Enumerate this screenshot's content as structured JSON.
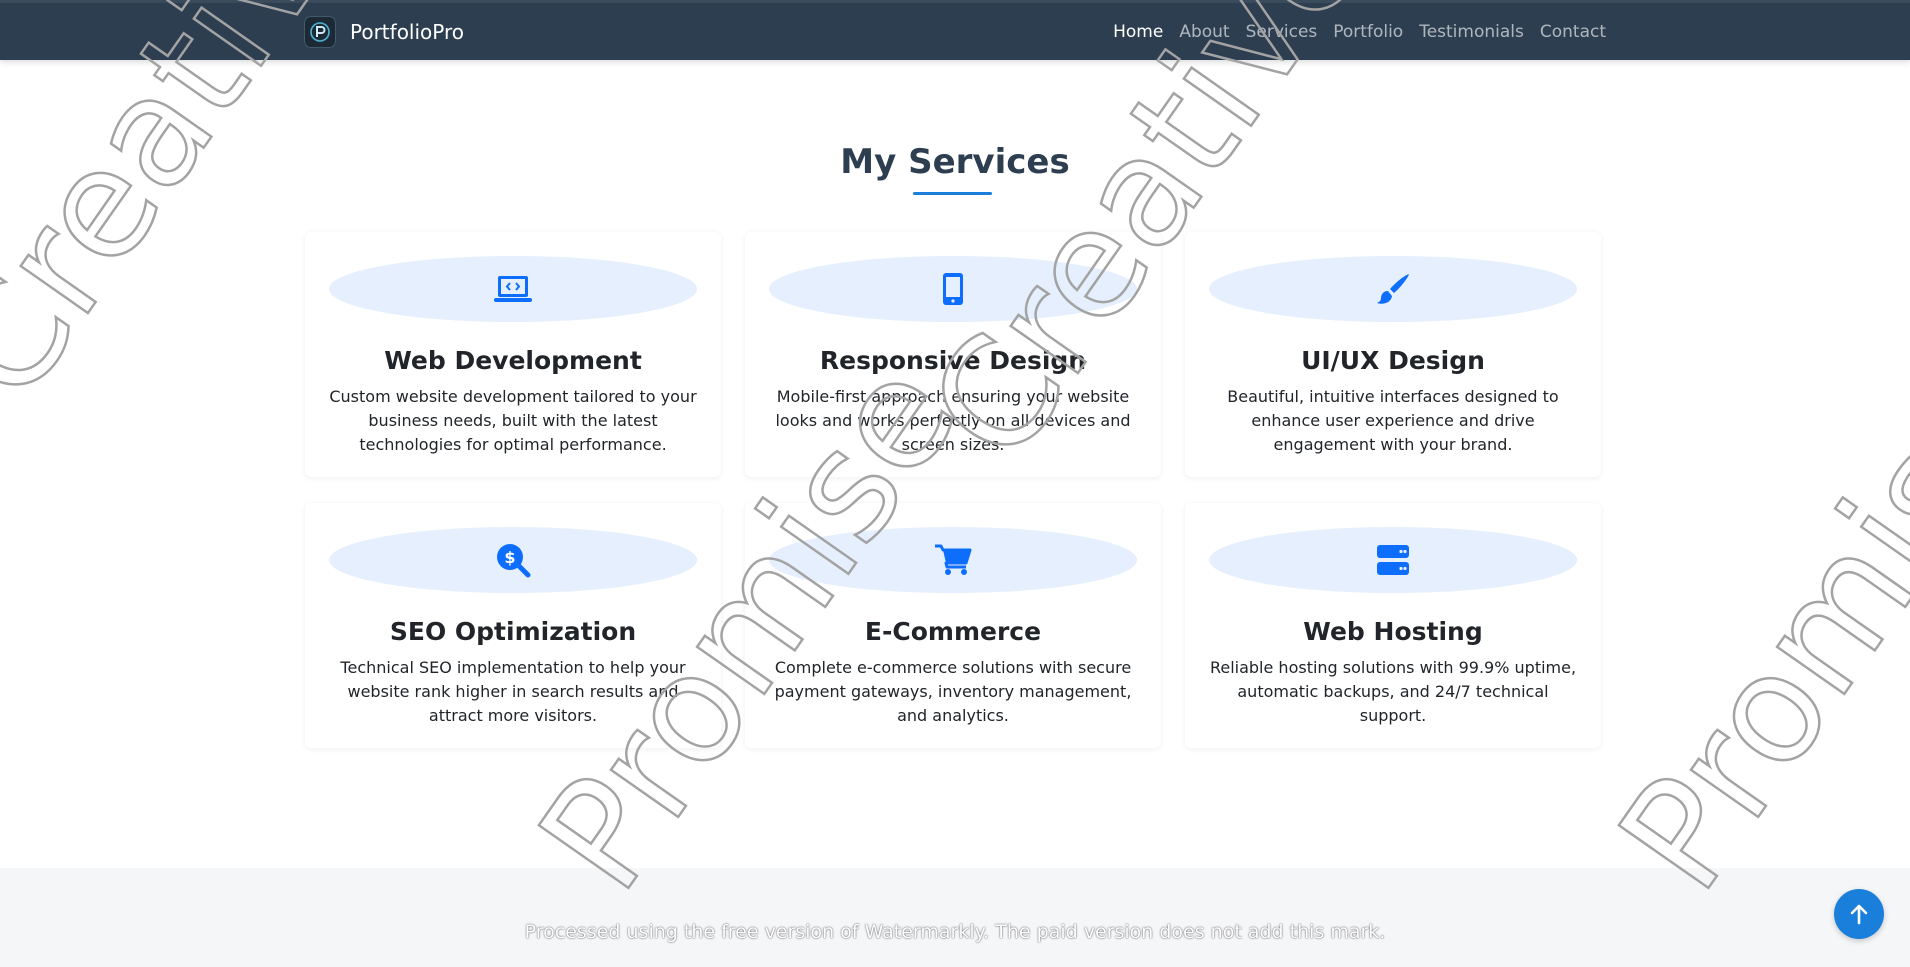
{
  "nav": {
    "brand": "PortfolioPro",
    "links": [
      "Home",
      "About",
      "Services",
      "Portfolio",
      "Testimonials",
      "Contact"
    ],
    "active": "Home"
  },
  "services": {
    "title": "My Services",
    "items": [
      {
        "icon": "laptop-code-icon",
        "title": "Web Development",
        "description": "Custom website development tailored to your business needs, built with the latest technologies for optimal performance."
      },
      {
        "icon": "mobile-icon",
        "title": "Responsive Design",
        "description": "Mobile-first approach ensuring your website looks and works perfectly on all devices and screen sizes."
      },
      {
        "icon": "paint-brush-icon",
        "title": "UI/UX Design",
        "description": "Beautiful, intuitive interfaces designed to enhance user experience and drive engagement with your brand."
      },
      {
        "icon": "search-dollar-icon",
        "title": "SEO Optimization",
        "description": "Technical SEO implementation to help your website rank higher in search results and attract more visitors."
      },
      {
        "icon": "shopping-cart-icon",
        "title": "E-Commerce",
        "description": "Complete e-commerce solutions with secure payment gateways, inventory management, and analytics."
      },
      {
        "icon": "server-icon",
        "title": "Web Hosting",
        "description": "Reliable hosting solutions with 99.9% uptime, automatic backups, and 24/7 technical support."
      }
    ]
  },
  "watermark": {
    "words": [
      "Creative",
      "Creative",
      "Promise",
      "Promise"
    ],
    "note": "Processed using the free version of Watermarkly. The paid version does not add this mark."
  },
  "colors": {
    "navbar": "#2c3e50",
    "accent": "#1a7fdb",
    "icon_bg": "#e6effd",
    "icon": "#0d6efd"
  }
}
